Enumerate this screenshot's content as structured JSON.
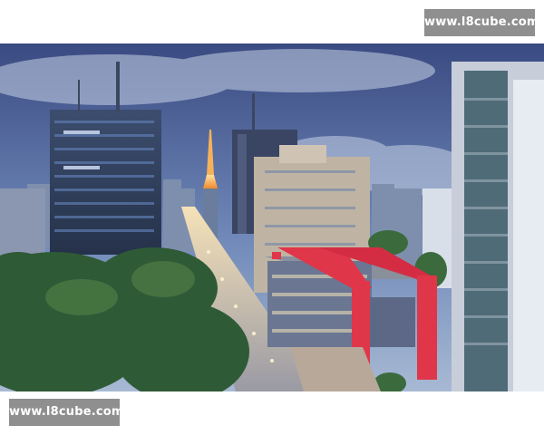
{
  "watermarks": {
    "top_right": "www.l8cube.com",
    "bottom_left": "www.l8cube.com"
  },
  "photo": {
    "subject": "city-avenue-dusk",
    "colors": {
      "sky_top": "#3e4f86",
      "sky_bottom": "#8aa4c8",
      "museum_red": "#e0364a",
      "tower_glow": "#ffb347",
      "trees": "#2f5a36"
    }
  }
}
